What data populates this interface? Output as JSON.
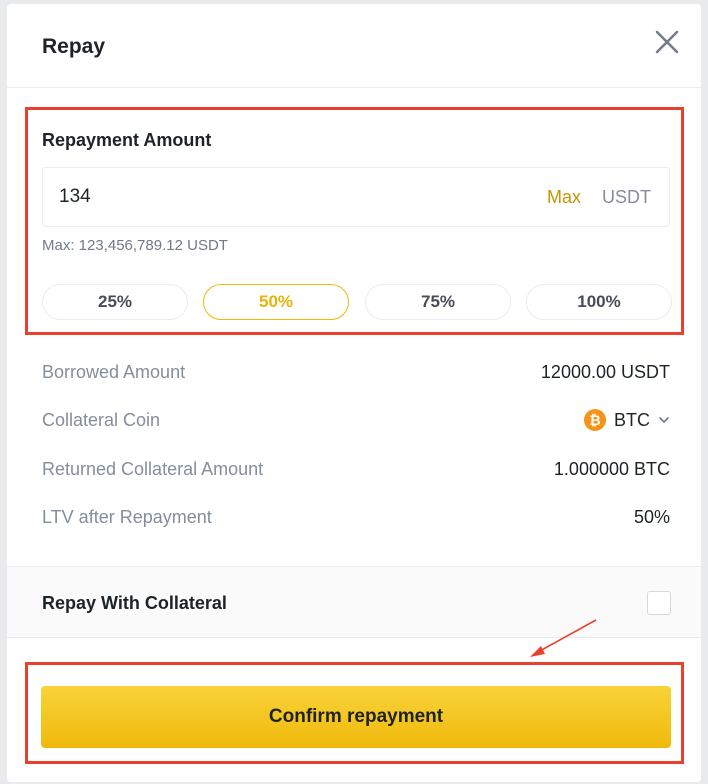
{
  "modal": {
    "title": "Repay"
  },
  "repayment": {
    "label": "Repayment Amount",
    "input_value": "134",
    "max_link": "Max",
    "unit": "USDT",
    "max_hint": "Max: 123,456,789.12 USDT",
    "percent_buttons": [
      "25%",
      "50%",
      "75%",
      "100%"
    ],
    "selected_percent": "50%"
  },
  "details": {
    "borrowed_label": "Borrowed Amount",
    "borrowed_value": "12000.00 USDT",
    "collateral_coin_label": "Collateral Coin",
    "collateral_coin_value": "BTC",
    "returned_label": "Returned Collateral Amount",
    "returned_value": "1.000000 BTC",
    "ltv_label": "LTV after Repayment",
    "ltv_value": "50%"
  },
  "repay_with_collateral": {
    "label": "Repay With Collateral",
    "checked": false
  },
  "confirm_button": "Confirm repayment",
  "icons": {
    "close": "close-icon",
    "bitcoin": "bitcoin-icon",
    "chevron": "chevron-down-icon"
  },
  "colors": {
    "accent": "#f0b90b",
    "accent_text": "#c99400",
    "highlight": "#e8422e",
    "btc": "#f7931a"
  }
}
